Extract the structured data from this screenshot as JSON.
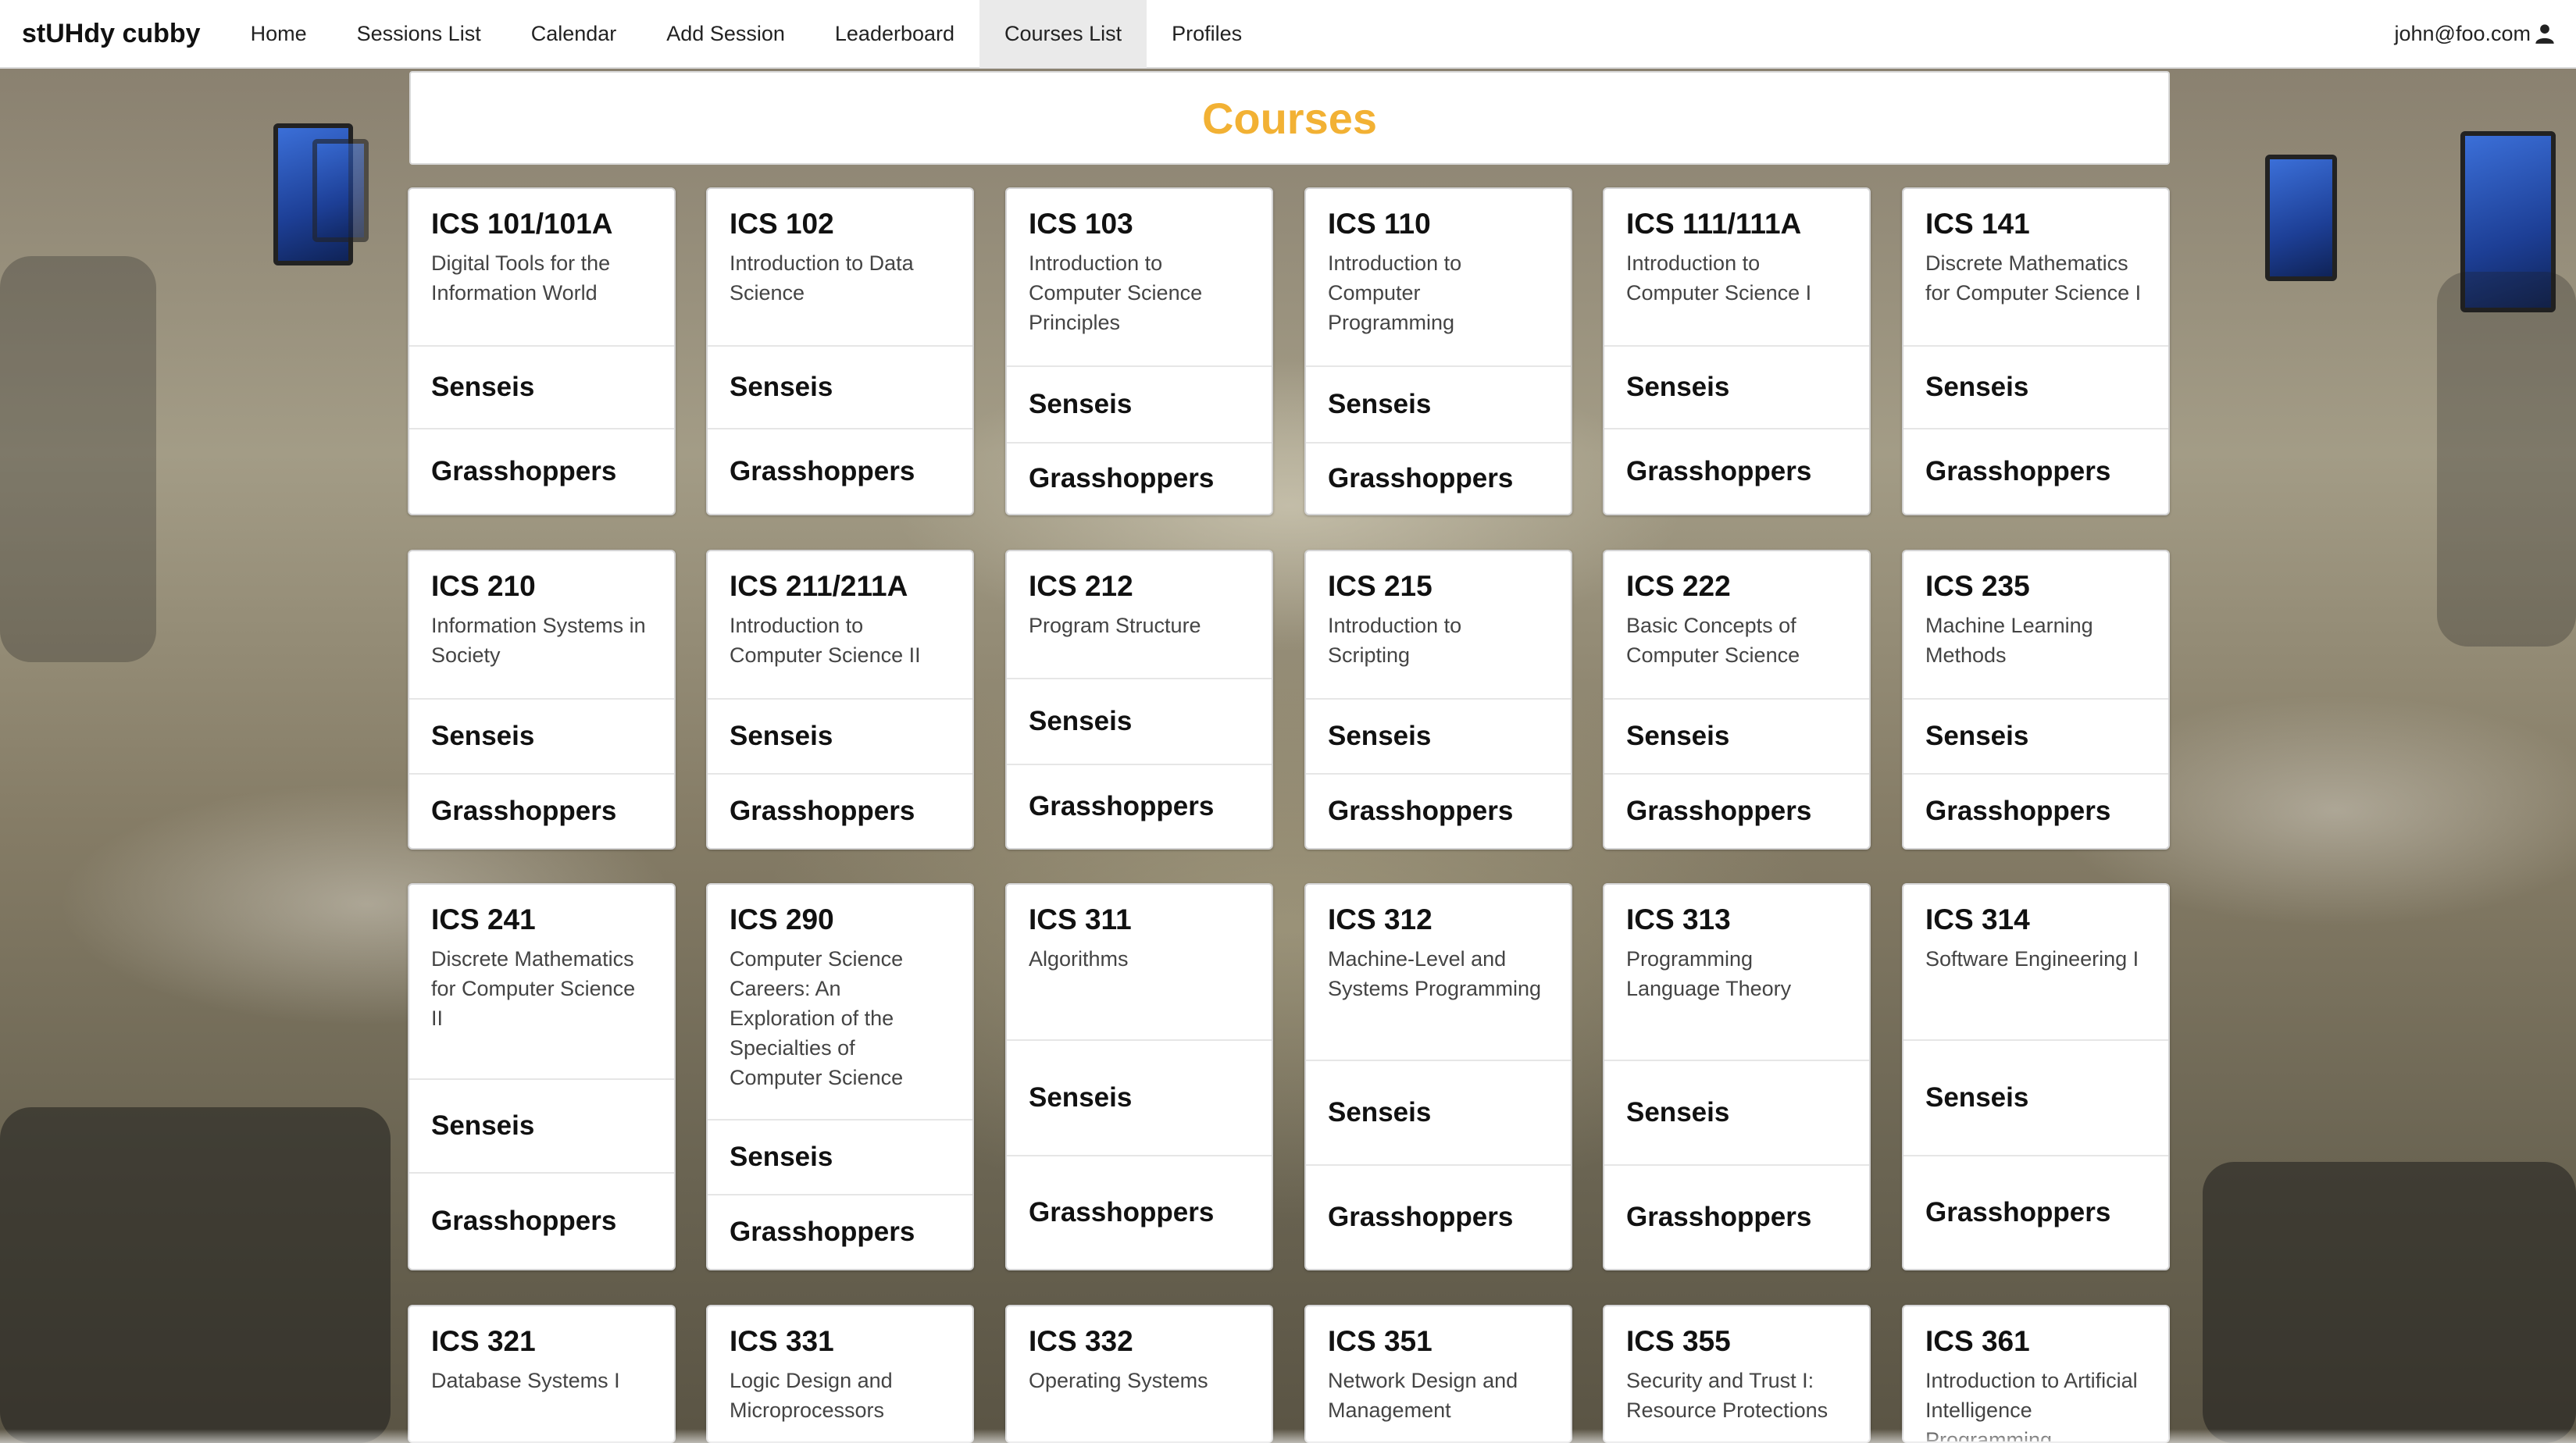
{
  "navbar": {
    "brand": "stUHdy cubby",
    "items": [
      {
        "label": "Home"
      },
      {
        "label": "Sessions List"
      },
      {
        "label": "Calendar"
      },
      {
        "label": "Add Session"
      },
      {
        "label": "Leaderboard"
      },
      {
        "label": "Courses List",
        "active": true
      },
      {
        "label": "Profiles"
      }
    ],
    "user_email": "john@foo.com",
    "user_icon": "user-icon"
  },
  "page": {
    "title": "Courses",
    "accent_color": "#f2b134"
  },
  "section_labels": {
    "senseis": "Senseis",
    "grasshoppers": "Grasshoppers"
  },
  "courses": [
    {
      "code": "ICS 101/101A",
      "name": "Digital Tools for the Information World"
    },
    {
      "code": "ICS 102",
      "name": "Introduction to Data Science"
    },
    {
      "code": "ICS 103",
      "name": "Introduction to Computer Science Principles"
    },
    {
      "code": "ICS 110",
      "name": "Introduction to Computer Programming"
    },
    {
      "code": "ICS 111/111A",
      "name": "Introduction to Computer Science I"
    },
    {
      "code": "ICS 141",
      "name": "Discrete Mathematics for Computer Science I"
    },
    {
      "code": "ICS 210",
      "name": "Information Systems in Society"
    },
    {
      "code": "ICS 211/211A",
      "name": "Introduction to Computer Science II"
    },
    {
      "code": "ICS 212",
      "name": "Program Structure"
    },
    {
      "code": "ICS 215",
      "name": "Introduction to Scripting"
    },
    {
      "code": "ICS 222",
      "name": "Basic Concepts of Computer Science"
    },
    {
      "code": "ICS 235",
      "name": "Machine Learning Methods"
    },
    {
      "code": "ICS 241",
      "name": "Discrete Mathematics for Computer Science II"
    },
    {
      "code": "ICS 290",
      "name": "Computer Science Careers: An Exploration of the Specialties of Computer Science"
    },
    {
      "code": "ICS 311",
      "name": "Algorithms"
    },
    {
      "code": "ICS 312",
      "name": "Machine-Level and Systems Programming"
    },
    {
      "code": "ICS 313",
      "name": "Programming Language Theory"
    },
    {
      "code": "ICS 314",
      "name": "Software Engineering I"
    },
    {
      "code": "ICS 321",
      "name": "Database Systems I"
    },
    {
      "code": "ICS 331",
      "name": "Logic Design and Microprocessors"
    },
    {
      "code": "ICS 332",
      "name": "Operating Systems"
    },
    {
      "code": "ICS 351",
      "name": "Network Design and Management"
    },
    {
      "code": "ICS 355",
      "name": "Security and Trust I: Resource Protections"
    },
    {
      "code": "ICS 361",
      "name": "Introduction to Artificial Intelligence Programming"
    }
  ]
}
